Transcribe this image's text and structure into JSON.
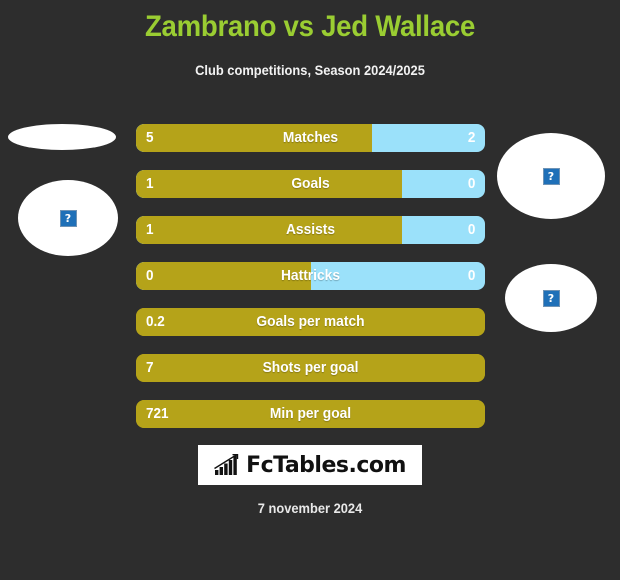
{
  "header": {
    "title": "Zambrano vs Jed Wallace",
    "subtitle": "Club competitions, Season 2024/2025",
    "title_color": "#9acd32"
  },
  "colors": {
    "background": "#2d2d2d",
    "bar_left": "#b5a319",
    "bar_right": "#9be1fa",
    "text": "#ffffff"
  },
  "players": {
    "left": {
      "placeholder_alt": "?"
    },
    "right": {
      "placeholder_alt": "?"
    }
  },
  "chart_data": {
    "type": "bar",
    "title": "Zambrano vs Jed Wallace",
    "subtitle": "Club competitions, Season 2024/2025",
    "orientation": "horizontal-diverging",
    "categories": [
      "Matches",
      "Goals",
      "Assists",
      "Hattricks",
      "Goals per match",
      "Shots per goal",
      "Min per goal"
    ],
    "series": [
      {
        "name": "Zambrano",
        "values": [
          "5",
          "1",
          "1",
          "0",
          "0.2",
          "7",
          "721"
        ],
        "color": "#b5a319"
      },
      {
        "name": "Jed Wallace",
        "values": [
          "2",
          "0",
          "0",
          "0",
          "",
          "",
          ""
        ],
        "color": "#9be1fa"
      }
    ],
    "rows": [
      {
        "label": "Matches",
        "left_value": "5",
        "right_value": "2",
        "left_pct": 67.6,
        "has_right": true
      },
      {
        "label": "Goals",
        "left_value": "1",
        "right_value": "0",
        "left_pct": 76.2,
        "has_right": true
      },
      {
        "label": "Assists",
        "left_value": "1",
        "right_value": "0",
        "left_pct": 76.2,
        "has_right": true
      },
      {
        "label": "Hattricks",
        "left_value": "0",
        "right_value": "0",
        "left_pct": 50.0,
        "has_right": true
      },
      {
        "label": "Goals per match",
        "left_value": "0.2",
        "right_value": "",
        "left_pct": 100,
        "has_right": false
      },
      {
        "label": "Shots per goal",
        "left_value": "7",
        "right_value": "",
        "left_pct": 100,
        "has_right": false
      },
      {
        "label": "Min per goal",
        "left_value": "721",
        "right_value": "",
        "left_pct": 100,
        "has_right": false
      }
    ],
    "grid": false,
    "legend": "none"
  },
  "logo": {
    "text": "FcTables.com",
    "icon": "bar-chart-growth-icon"
  },
  "footer": {
    "date": "7 november 2024"
  }
}
